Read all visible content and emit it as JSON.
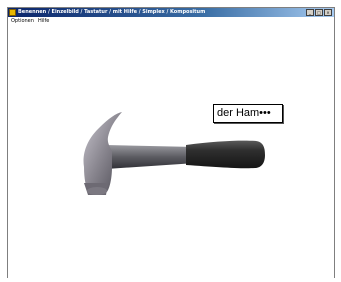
{
  "window": {
    "title": "Benennen / Einzelbild / Tastatur / mit Hilfe / Simplex / Kompositum",
    "controls": [
      "_",
      "□",
      "×"
    ]
  },
  "menu": {
    "items": [
      "Optionen",
      "Hilfe"
    ]
  },
  "word_label": "der Ham•••",
  "image": {
    "subject": "hammer",
    "colors": {
      "head": "#8a8790",
      "handle": "#2f2f2f"
    }
  }
}
